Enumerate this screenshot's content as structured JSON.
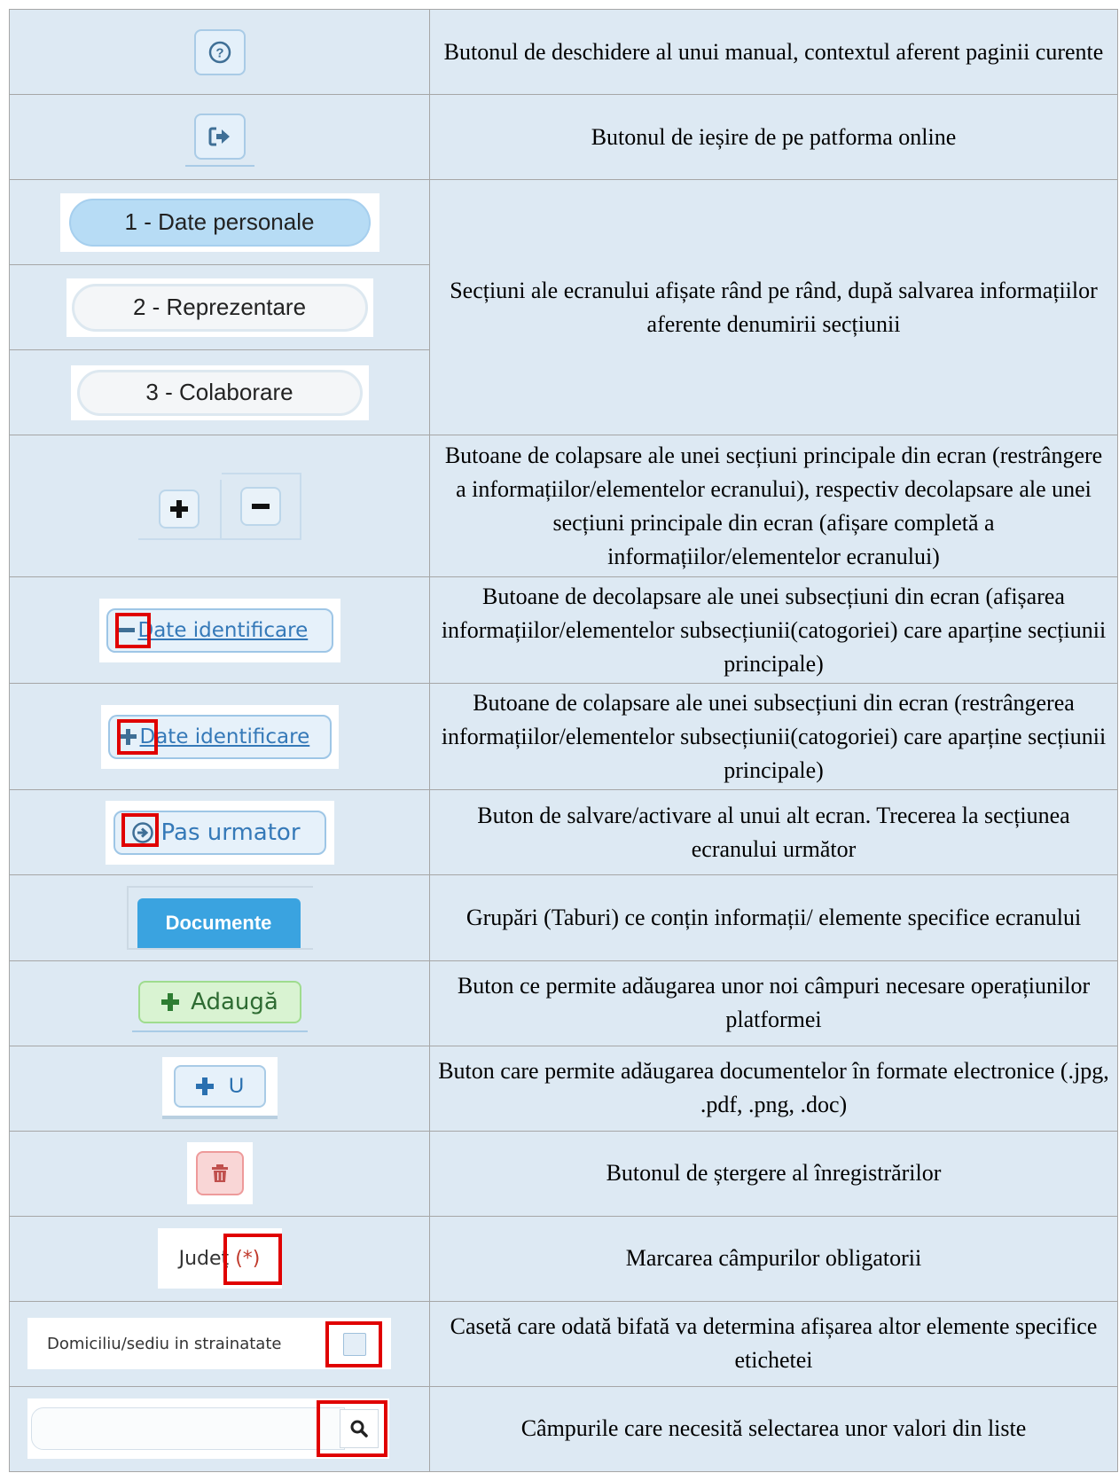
{
  "rows": [
    {
      "id": "help",
      "description": "Butonul de deschidere al unui manual, contextul aferent paginii curente"
    },
    {
      "id": "logout",
      "description": "Butonul de ieșire de pe patforma online"
    },
    {
      "id": "sections",
      "description": "Secțiuni ale ecranului afișate rând pe rând, după salvarea informațiilor aferente denumirii secțiunii"
    },
    {
      "id": "collapse-main",
      "description": "Butoane de colapsare ale unei secțiuni principale din ecran (restrângere a informațiilor/elementelor ecranului), respectiv decolapsare ale unei secțiuni principale din ecran (afișare completă a informațiilor/elementelor ecranului)"
    },
    {
      "id": "decollapse-sub",
      "description": "Butoane de decolapsare ale unei subsecțiuni din ecran (afișarea informațiilor/elementelor subsecțiunii(catogoriei) care aparține secțiunii principale)"
    },
    {
      "id": "collapse-sub",
      "description": "Butoane de colapsare ale unei subsecțiuni din ecran (restrângerea informațiilor/elementelor subsecțiunii(catogoriei) care aparține secțiunii principale)"
    },
    {
      "id": "next-step",
      "description": "Buton de salvare/activare al unui alt ecran. Trecerea la secțiunea ecranului următor"
    },
    {
      "id": "tabs",
      "description": "Grupări (Taburi) ce conțin informații/ elemente specifice ecranului"
    },
    {
      "id": "add",
      "description": "Buton ce permite adăugarea unor noi câmpuri necesare operațiunilor platformei"
    },
    {
      "id": "upload",
      "description": "Buton care permite adăugarea documentelor în formate electronice (.jpg, .pdf, .png, .doc)"
    },
    {
      "id": "delete",
      "description": "Butonul de ștergere al înregistrărilor"
    },
    {
      "id": "required",
      "description": "Marcarea câmpurilor obligatorii"
    },
    {
      "id": "checkbox",
      "description": "Casetă care odată bifată va determina afișarea altor elemente specifice etichetei"
    },
    {
      "id": "lookup",
      "description": "Câmpurile care necesită selectarea unor valori din liste"
    }
  ],
  "samples": {
    "section1": "1 - Date personale",
    "section2": "2 - Reprezentare",
    "section3": "3 - Colaborare",
    "subsection_label": "Date identificare",
    "next_label": "Pas urmator",
    "tab_label": "Documente",
    "add_label": "Adaugă",
    "upload_label": "U",
    "required_field_label": "Judeţ",
    "required_marker": "(*)",
    "checkbox_label": "Domiciliu/sediu in strainatate"
  },
  "icons": {
    "help": "question-circle-icon",
    "logout": "sign-out-icon",
    "plus": "plus-icon",
    "minus": "minus-icon",
    "next": "arrow-circle-right-icon",
    "delete": "trash-icon",
    "search": "search-icon"
  },
  "colors": {
    "highlight": "#e00000",
    "tab_blue": "#3aa3e0",
    "add_green": "#d9f3d2",
    "delete_red": "#f9d6d6",
    "table_bg": "#dde9f3"
  }
}
